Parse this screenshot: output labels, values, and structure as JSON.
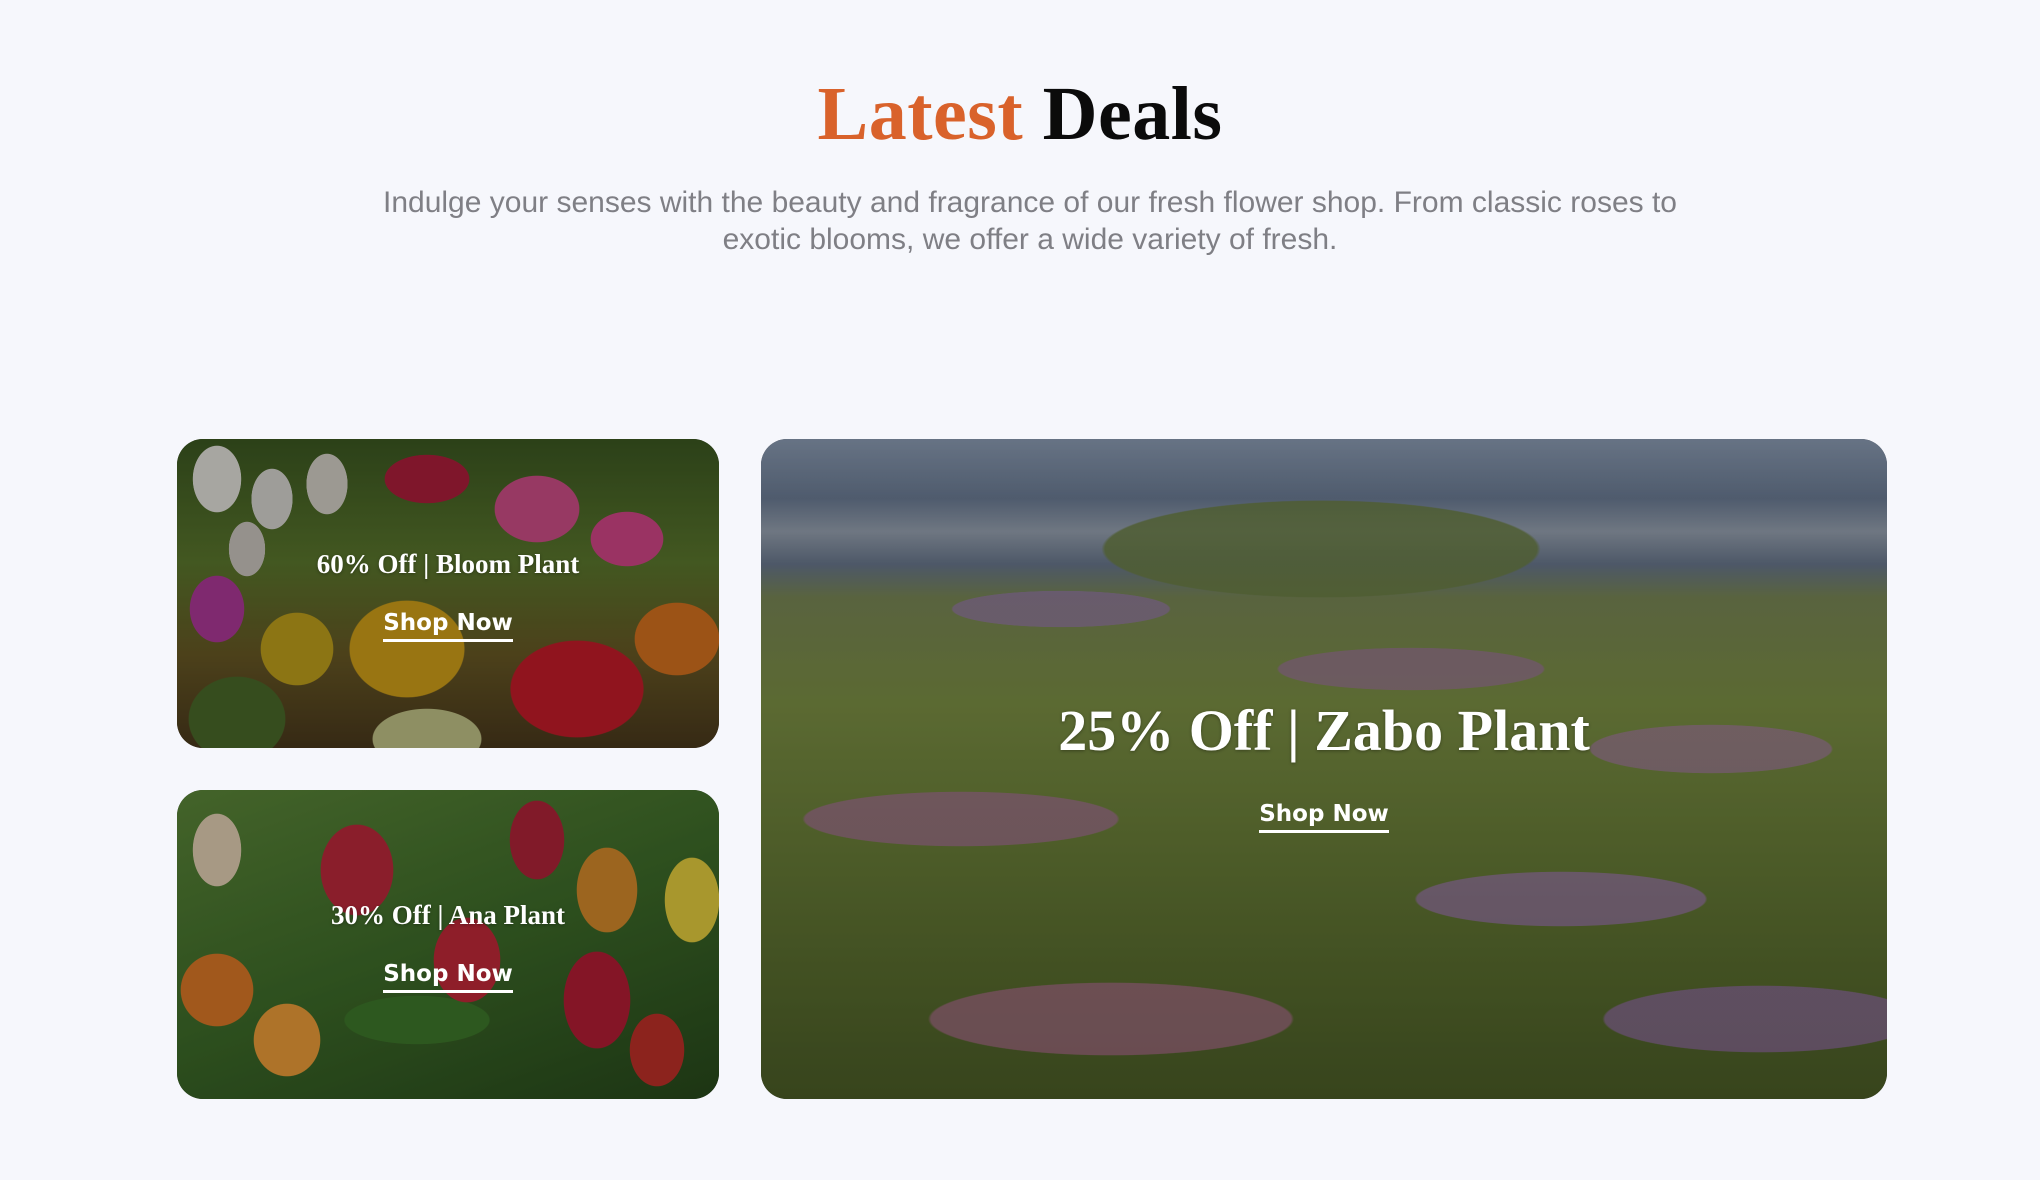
{
  "section": {
    "title_accent": "Latest",
    "title_rest": "Deals",
    "subtitle": "Indulge your senses with the beauty and fragrance of our fresh flower shop. From classic roses to exotic blooms, we offer a wide variety of fresh.",
    "colors": {
      "accent": "#d9622b",
      "background": "#f6f7fc",
      "subtitle_text": "#7f7f85"
    }
  },
  "deals": [
    {
      "title": "60% Off | Bloom Plant",
      "link_label": "Shop Now",
      "image": "tulips-field-photo"
    },
    {
      "title": "30% Off | Ana Plant",
      "link_label": "Shop Now",
      "image": "tulips-closeup-photo"
    },
    {
      "title": "25% Off | Zabo Plant",
      "link_label": "Shop Now",
      "image": "flower-meadow-photo"
    }
  ]
}
